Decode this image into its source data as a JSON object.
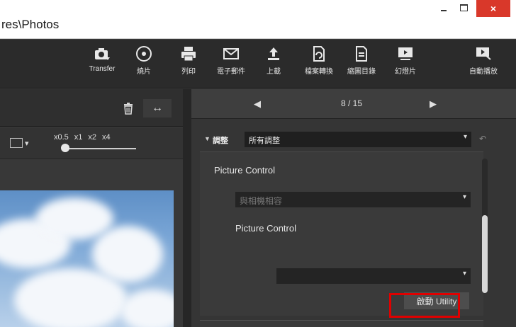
{
  "window": {
    "title": "res\\Photos",
    "minimize": "–",
    "maximize": "□",
    "close": "×"
  },
  "toolbar": {
    "items": [
      {
        "label": "Transfer",
        "icon": "camera-transfer-icon"
      },
      {
        "label": "燒片",
        "icon": "disc-burn-icon"
      },
      {
        "label": "列印",
        "icon": "printer-icon"
      },
      {
        "label": "電子郵件",
        "icon": "mail-icon"
      },
      {
        "label": "上載",
        "icon": "upload-icon"
      },
      {
        "label": "檔案轉換",
        "icon": "file-convert-icon"
      },
      {
        "label": "縮圖目錄",
        "icon": "thumbnail-index-icon"
      },
      {
        "label": "幻燈片",
        "icon": "slideshow-icon"
      },
      {
        "label": "自動播放",
        "icon": "autoplay-icon"
      }
    ]
  },
  "left": {
    "swap_label": "↔",
    "zoom_levels": [
      "x0.5",
      "x1",
      "x2",
      "x4"
    ]
  },
  "nav": {
    "prev": "◀",
    "counter": "8 / 15",
    "next": "▶"
  },
  "adjust": {
    "label": "調整",
    "select_value": "所有調整"
  },
  "picture_control": {
    "label": "Picture Control",
    "camera_select": "與相機相容",
    "label2": "Picture Control",
    "launch_button": "啟動 Utility"
  }
}
